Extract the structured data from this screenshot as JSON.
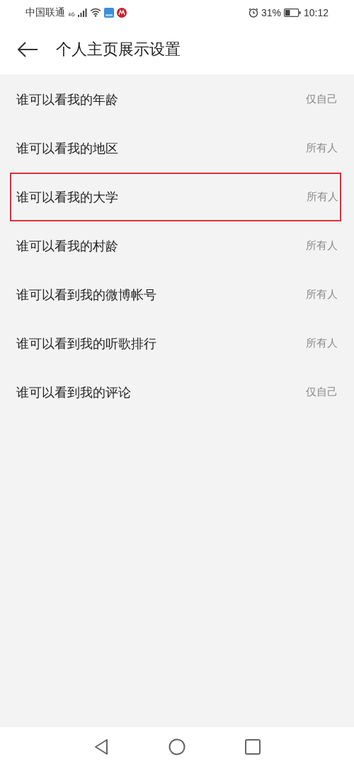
{
  "status_bar": {
    "carrier": "中国联通",
    "network": "4G",
    "battery": "31%",
    "time": "10:12"
  },
  "header": {
    "title": "个人主页展示设置"
  },
  "settings": [
    {
      "label": "谁可以看我的年龄",
      "value": "仅自己",
      "highlighted": false
    },
    {
      "label": "谁可以看我的地区",
      "value": "所有人",
      "highlighted": false
    },
    {
      "label": "谁可以看我的大学",
      "value": "所有人",
      "highlighted": true
    },
    {
      "label": "谁可以看我的村龄",
      "value": "所有人",
      "highlighted": false
    },
    {
      "label": "谁可以看到我的微博帐号",
      "value": "所有人",
      "highlighted": false
    },
    {
      "label": "谁可以看到我的听歌排行",
      "value": "所有人",
      "highlighted": false
    },
    {
      "label": "谁可以看到我的评论",
      "value": "仅自己",
      "highlighted": false
    }
  ]
}
